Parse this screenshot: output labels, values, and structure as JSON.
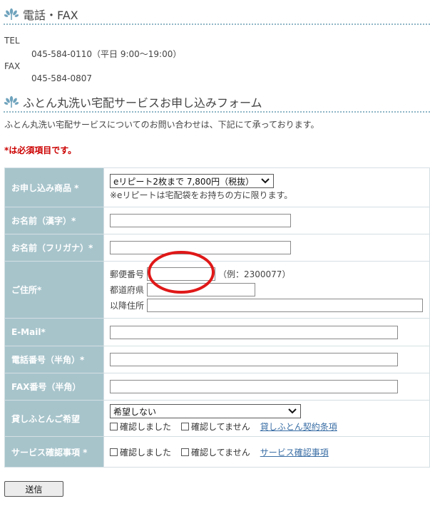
{
  "contact": {
    "heading": "電話・FAX",
    "tel_label": "TEL",
    "tel_value": "045-584-0110（平日 9:00〜19:00）",
    "fax_label": "FAX",
    "fax_value": "045-584-0807"
  },
  "form_section": {
    "heading": "ふとん丸洗い宅配サービスお申し込みフォーム",
    "intro": "ふとん丸洗い宅配サービスについてのお問い合わせは、下記にて承っております。",
    "required_note": "*は必須項目です。"
  },
  "rows": {
    "product": {
      "label": "お申し込み商品 *",
      "select_value": "eリピート2枚まで  7,800円（税抜）",
      "note": "※eリピートは宅配袋をお持ちの方に限ります。"
    },
    "name_kanji": {
      "label": "お名前（漢字）*",
      "value": ""
    },
    "name_kana": {
      "label": "お名前（フリガナ）*",
      "value": ""
    },
    "address": {
      "label": "ご住所*",
      "postal_label": "郵便番号",
      "postal_value": "",
      "postal_example": "（例：2300077）",
      "prefecture_label": "都道府県",
      "prefecture_value": "",
      "street_label": "以降住所",
      "street_value": ""
    },
    "email": {
      "label": "E-Mail*",
      "value": ""
    },
    "phone": {
      "label": "電話番号（半角）*",
      "value": ""
    },
    "fax": {
      "label": "FAX番号（半角）",
      "value": ""
    },
    "rental": {
      "label": "貸しふとんご希望",
      "select_value": "希望しない",
      "confirmed": "確認しました",
      "not_confirmed": "確認してません",
      "link": "貸しふとん契約条項"
    },
    "service_confirm": {
      "label": "サービス確認事項 *",
      "confirmed": "確認しました",
      "not_confirmed": "確認してません",
      "link": "サービス確認事項"
    }
  },
  "submit_label": "送信",
  "colors": {
    "label_bg": "#a7c4cb",
    "dotted_rule": "#8fb6c6",
    "required": "#cc0000",
    "link": "#3a6ea5",
    "annotation_circle": "#e01818"
  },
  "icons": {
    "heading_bullet": "flower-ornament-icon"
  }
}
